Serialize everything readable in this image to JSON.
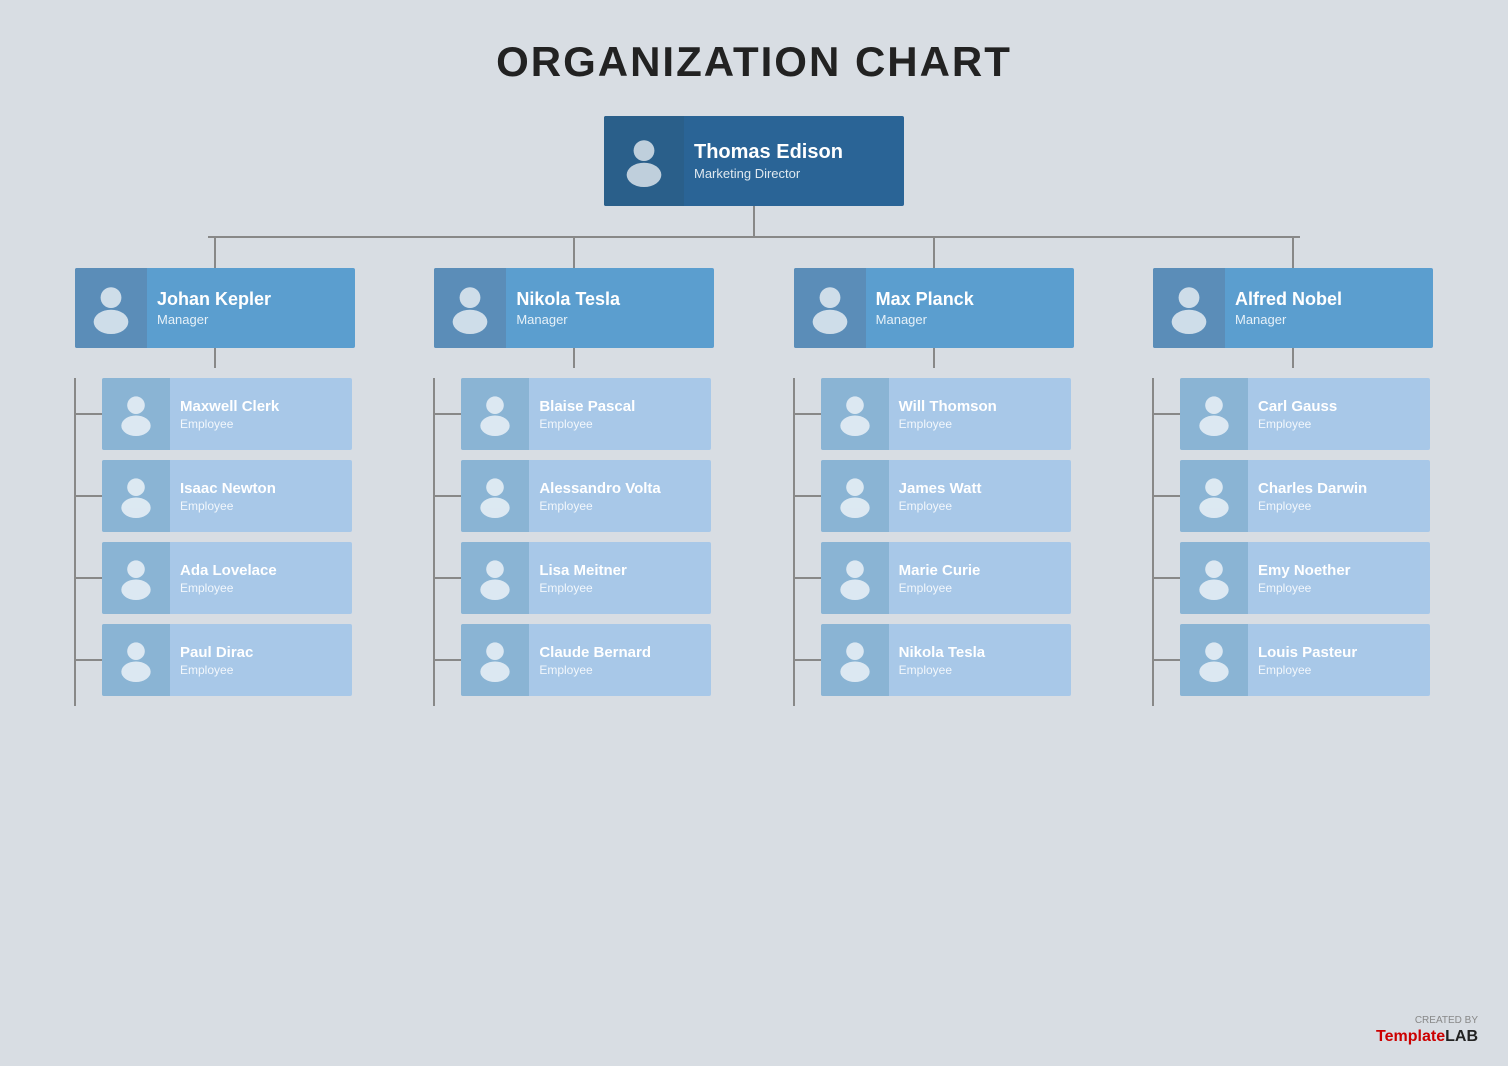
{
  "title": "ORGANIZATION CHART",
  "director": {
    "name": "Thomas Edison",
    "role": "Marketing Director"
  },
  "managers": [
    {
      "name": "Johan Kepler",
      "role": "Manager"
    },
    {
      "name": "Nikola Tesla",
      "role": "Manager"
    },
    {
      "name": "Max Planck",
      "role": "Manager"
    },
    {
      "name": "Alfred Nobel",
      "role": "Manager"
    }
  ],
  "employees": [
    [
      {
        "name": "Maxwell Clerk",
        "role": "Employee"
      },
      {
        "name": "Isaac Newton",
        "role": "Employee"
      },
      {
        "name": "Ada Lovelace",
        "role": "Employee"
      },
      {
        "name": "Paul Dirac",
        "role": "Employee"
      }
    ],
    [
      {
        "name": "Blaise Pascal",
        "role": "Employee"
      },
      {
        "name": "Alessandro Volta",
        "role": "Employee"
      },
      {
        "name": "Lisa Meitner",
        "role": "Employee"
      },
      {
        "name": "Claude Bernard",
        "role": "Employee"
      }
    ],
    [
      {
        "name": "Will Thomson",
        "role": "Employee"
      },
      {
        "name": "James Watt",
        "role": "Employee"
      },
      {
        "name": "Marie Curie",
        "role": "Employee"
      },
      {
        "name": "Nikola Tesla",
        "role": "Employee"
      }
    ],
    [
      {
        "name": "Carl Gauss",
        "role": "Employee"
      },
      {
        "name": "Charles Darwin",
        "role": "Employee"
      },
      {
        "name": "Emy Noether",
        "role": "Employee"
      },
      {
        "name": "Louis Pasteur",
        "role": "Employee"
      }
    ]
  ],
  "watermark": {
    "created_by": "CREATED BY",
    "template": "Template",
    "lab": "LAB"
  }
}
